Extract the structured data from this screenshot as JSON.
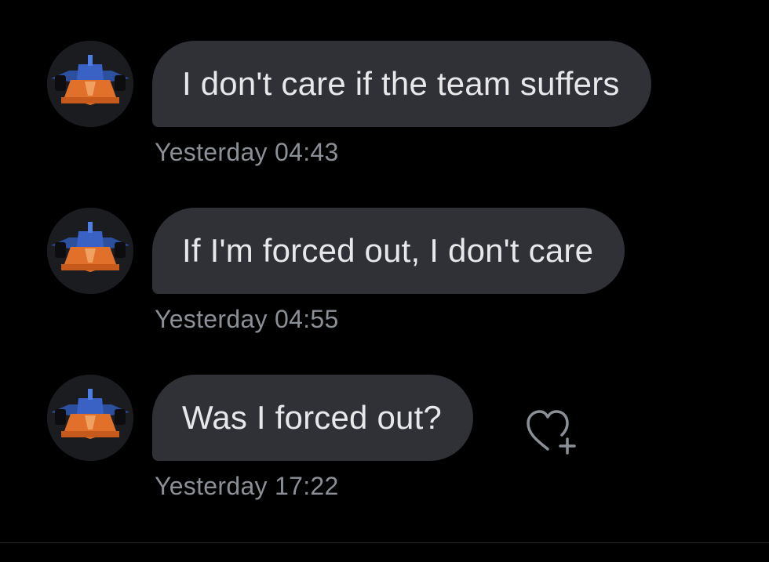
{
  "conversation": {
    "messages": [
      {
        "text": "I don't care if the team suffers",
        "timestamp": "Yesterday 04:43"
      },
      {
        "text": "If I'm forced out, I don't care",
        "timestamp": "Yesterday 04:55"
      },
      {
        "text": "Was I forced out?",
        "timestamp": "Yesterday 17:22"
      }
    ]
  },
  "icons": {
    "avatar": "race-car-avatar",
    "react": "heart-add-icon"
  },
  "colors": {
    "background": "#000000",
    "bubble": "#2f3136",
    "text": "#e8e8ea",
    "timestamp": "#8b8f96"
  }
}
